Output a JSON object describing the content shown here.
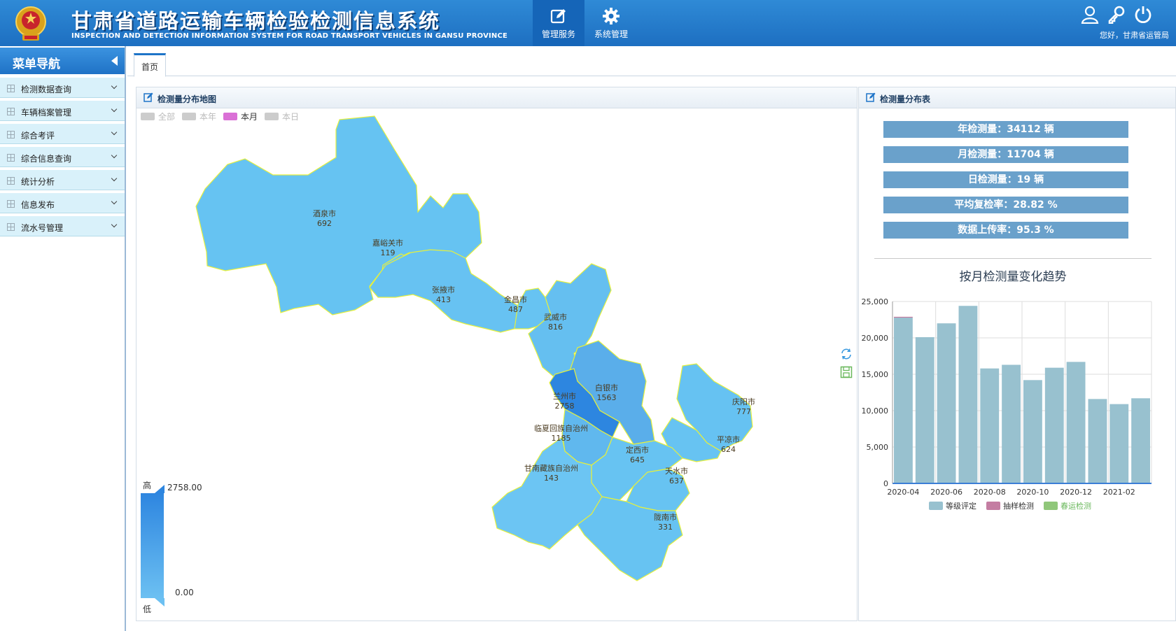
{
  "header": {
    "title_cn": "甘肃省道路运输车辆检验检测信息系统",
    "title_en": "INSPECTION AND DETECTION INFORMATION SYSTEM FOR ROAD TRANSPORT VEHICLES IN GANSU PROVINCE",
    "nav": [
      {
        "label": "管理服务",
        "icon": "edit-icon",
        "active": true
      },
      {
        "label": "系统管理",
        "icon": "gear-icon",
        "active": false
      }
    ],
    "welcome": "您好，甘肃省运管局",
    "icons": [
      "user-icon",
      "key-icon",
      "power-icon"
    ]
  },
  "sidebar": {
    "title": "菜单导航",
    "items": [
      {
        "label": "检测数据查询"
      },
      {
        "label": "车辆档案管理"
      },
      {
        "label": "综合考评"
      },
      {
        "label": "综合信息查询"
      },
      {
        "label": "统计分析"
      },
      {
        "label": "信息发布"
      },
      {
        "label": "流水号管理"
      }
    ]
  },
  "tabs": [
    {
      "label": "首页"
    }
  ],
  "map_panel": {
    "title": "检测量分布地图",
    "legend": [
      {
        "label": "全部",
        "color": "#cccccc",
        "active": false
      },
      {
        "label": "本年",
        "color": "#cccccc",
        "active": false
      },
      {
        "label": "本月",
        "color": "#da70d6",
        "active": true
      },
      {
        "label": "本日",
        "color": "#cccccc",
        "active": false
      }
    ],
    "regions": [
      {
        "name": "酒泉市",
        "value": 692
      },
      {
        "name": "嘉峪关市",
        "value": 119
      },
      {
        "name": "张掖市",
        "value": 413
      },
      {
        "name": "金昌市",
        "value": 487
      },
      {
        "name": "武威市",
        "value": 816
      },
      {
        "name": "白银市",
        "value": 1563
      },
      {
        "name": "兰州市",
        "value": 2758
      },
      {
        "name": "庆阳市",
        "value": 777
      },
      {
        "name": "临夏回族自治州",
        "value": 1185
      },
      {
        "name": "平凉市",
        "value": 624
      },
      {
        "name": "定西市",
        "value": 645
      },
      {
        "name": "甘南藏族自治州",
        "value": 143
      },
      {
        "name": "天水市",
        "value": 637
      },
      {
        "name": "陇南市",
        "value": 331
      }
    ],
    "visual_map": {
      "high_label": "高",
      "low_label": "低",
      "max": "2758.00",
      "min": "0.00"
    }
  },
  "stats_panel": {
    "title": "检测量分布表",
    "stats": [
      "年检测量：34112 辆",
      "月检测量：11704 辆",
      "日检测量：19 辆",
      "平均复检率：28.82 %",
      "数据上传率：95.3 %"
    ],
    "chart_title": "按月检测量变化趋势",
    "tool_icons": [
      "refresh-icon",
      "save-icon"
    ]
  },
  "chart_data": {
    "type": "bar",
    "title": "按月检测量变化趋势",
    "categories": [
      "2020-04",
      "2020-05",
      "2020-06",
      "2020-07",
      "2020-08",
      "2020-09",
      "2020-10",
      "2020-11",
      "2020-12",
      "2021-01",
      "2021-02",
      "2021-03"
    ],
    "x_tick_labels": [
      "2020-04",
      "2020-06",
      "2020-08",
      "2020-10",
      "2020-12",
      "2021-02"
    ],
    "y_ticks": [
      "0",
      "5,000",
      "10,000",
      "15,000",
      "20,000",
      "25,000"
    ],
    "ylim": [
      0,
      25000
    ],
    "series": [
      {
        "name": "等级评定",
        "color": "#98c1cf",
        "values": [
          22800,
          20100,
          22000,
          24400,
          15800,
          16300,
          14200,
          15900,
          16700,
          11600,
          10900,
          11700
        ]
      },
      {
        "name": "抽样检测",
        "color": "#c47da2",
        "values": [
          100,
          0,
          0,
          0,
          0,
          0,
          0,
          0,
          0,
          0,
          0,
          0
        ]
      },
      {
        "name": "春运检测",
        "color": "#90c77a",
        "values": [
          0,
          0,
          0,
          0,
          0,
          0,
          0,
          0,
          0,
          0,
          0,
          0
        ]
      }
    ],
    "grid": true,
    "legend_position": "bottom"
  }
}
